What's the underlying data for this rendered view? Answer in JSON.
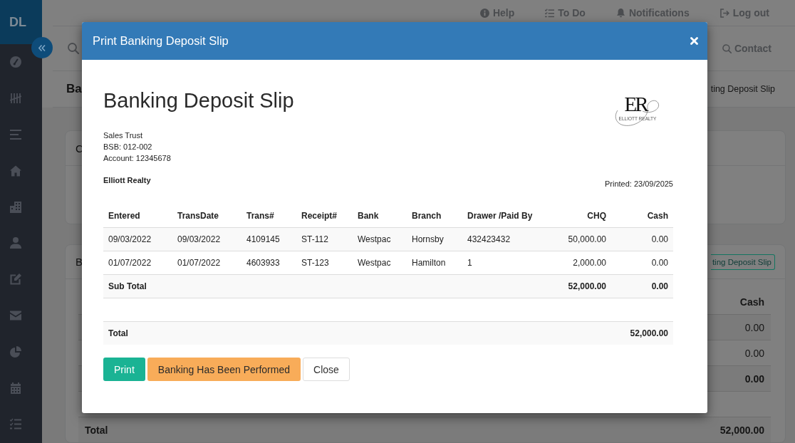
{
  "sidebar": {
    "logo": "DL"
  },
  "top_bar": {
    "links": [
      {
        "label": "Help"
      },
      {
        "label": "To Do"
      },
      {
        "label": "Notifications"
      },
      {
        "label": "Log out"
      }
    ]
  },
  "search_bar": {
    "link": "Contact"
  },
  "page_header": {
    "title": "Ba",
    "breadcrumb": "ting Deposit Slip"
  },
  "cards": [
    {
      "title": "C"
    },
    {
      "title": "B",
      "button": "ting Deposit Slip",
      "table": {
        "columns": [
          "Cash"
        ],
        "rows": [
          {
            "kind": "entry",
            "cash": "0.00"
          },
          {
            "kind": "entry",
            "cash": "0.00"
          },
          {
            "kind": "subtotal",
            "cash": "0.00"
          },
          {
            "kind": "spacer"
          },
          {
            "kind": "total",
            "label": "Total",
            "cash": "52,000.00"
          }
        ]
      }
    }
  ],
  "modal": {
    "title": "Print Banking Deposit Slip",
    "heading": "Banking Deposit Slip",
    "logo": {
      "initials": "ER",
      "tagline": "ELLIOTT REALTY"
    },
    "account_lines": [
      "Sales Trust",
      "BSB: 012-002",
      "Account: 12345678"
    ],
    "company": "Elliott Realty",
    "printed": "Printed: 23/09/2025",
    "table": {
      "columns": [
        {
          "label": "Entered",
          "kind": "text"
        },
        {
          "label": "TransDate",
          "kind": "text"
        },
        {
          "label": "Trans#",
          "kind": "text"
        },
        {
          "label": "Receipt#",
          "kind": "text"
        },
        {
          "label": "Bank",
          "kind": "text"
        },
        {
          "label": "Branch",
          "kind": "text"
        },
        {
          "label": "Drawer /Paid By",
          "kind": "text"
        },
        {
          "label": "CHQ",
          "kind": "amount"
        },
        {
          "label": "Cash",
          "kind": "amount"
        }
      ],
      "rows": [
        {
          "kind": "entry",
          "cells": [
            "09/03/2022",
            "09/03/2022",
            "4109145",
            "ST-112",
            "Westpac",
            "Hornsby",
            "432423432",
            "50,000.00",
            "0.00"
          ]
        },
        {
          "kind": "entry",
          "cells": [
            "01/07/2022",
            "01/07/2022",
            "4603933",
            "ST-123",
            "Westpac",
            "Hamilton",
            "1",
            "2,000.00",
            "0.00"
          ]
        },
        {
          "kind": "subtotal",
          "label": "Sub Total",
          "chq": "52,000.00",
          "cash": "0.00"
        },
        {
          "kind": "spacer"
        },
        {
          "kind": "total",
          "label": "Total",
          "amount": "52,000.00"
        }
      ]
    },
    "buttons": [
      {
        "label": "Print",
        "kind": "success"
      },
      {
        "label": "Banking Has Been Performed",
        "kind": "warning"
      },
      {
        "label": "Close",
        "kind": "default"
      }
    ]
  }
}
